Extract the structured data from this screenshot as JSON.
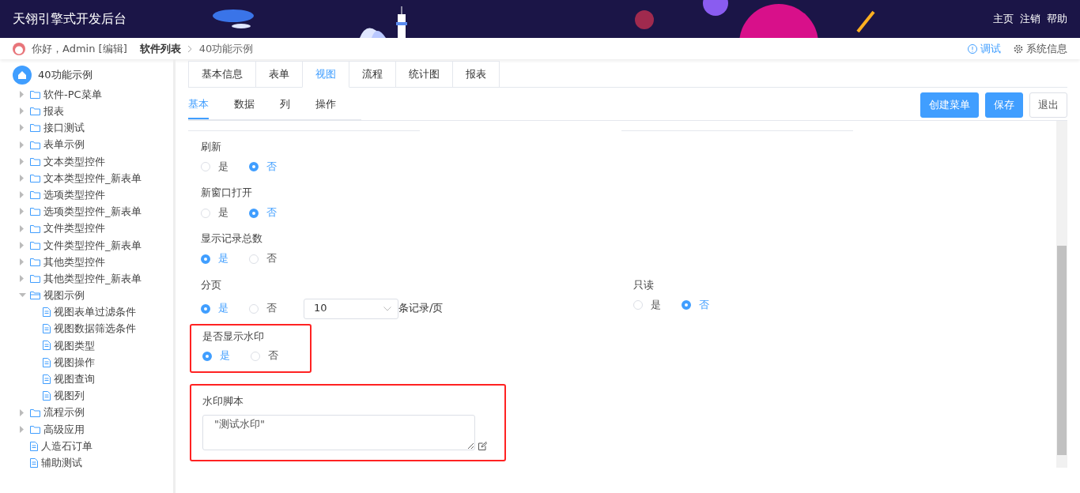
{
  "header": {
    "title": "天翎引擎式开发后台",
    "links": [
      "主页",
      "注销",
      "帮助"
    ]
  },
  "breadcrumb": {
    "greeting": "你好，Admin [编辑]",
    "items": [
      "软件列表",
      "40功能示例"
    ],
    "actions": [
      {
        "kind": "info",
        "label": "调试"
      },
      {
        "kind": "gear",
        "label": "系统信息"
      }
    ]
  },
  "tree": {
    "root": "40功能示例",
    "items": [
      {
        "kind": "folder",
        "label": "软件-PC菜单",
        "expanded": false
      },
      {
        "kind": "folder",
        "label": "报表",
        "expanded": false
      },
      {
        "kind": "folder",
        "label": "接口测试",
        "expanded": false
      },
      {
        "kind": "folder",
        "label": "表单示例",
        "expanded": false
      },
      {
        "kind": "folder",
        "label": "文本类型控件",
        "expanded": false
      },
      {
        "kind": "folder",
        "label": "文本类型控件_新表单",
        "expanded": false
      },
      {
        "kind": "folder",
        "label": "选项类型控件",
        "expanded": false
      },
      {
        "kind": "folder",
        "label": "选项类型控件_新表单",
        "expanded": false
      },
      {
        "kind": "folder",
        "label": "文件类型控件",
        "expanded": false
      },
      {
        "kind": "folder",
        "label": "文件类型控件_新表单",
        "expanded": false
      },
      {
        "kind": "folder",
        "label": "其他类型控件",
        "expanded": false
      },
      {
        "kind": "folder",
        "label": "其他类型控件_新表单",
        "expanded": false
      },
      {
        "kind": "folder",
        "label": "视图示例",
        "expanded": true,
        "children": [
          {
            "kind": "file",
            "label": "视图表单过滤条件"
          },
          {
            "kind": "file",
            "label": "视图数据筛选条件"
          },
          {
            "kind": "file",
            "label": "视图类型"
          },
          {
            "kind": "file",
            "label": "视图操作"
          },
          {
            "kind": "file",
            "label": "视图查询"
          },
          {
            "kind": "file",
            "label": "视图列"
          }
        ]
      },
      {
        "kind": "folder",
        "label": "流程示例",
        "expanded": false
      },
      {
        "kind": "folder",
        "label": "高级应用",
        "expanded": false
      },
      {
        "kind": "file",
        "label": "人造石订单"
      },
      {
        "kind": "file",
        "label": "辅助测试"
      }
    ]
  },
  "tabs": [
    {
      "label": "基本信息",
      "selected": false
    },
    {
      "label": "表单",
      "selected": false
    },
    {
      "label": "视图",
      "selected": true
    },
    {
      "label": "流程",
      "selected": false
    },
    {
      "label": "统计图",
      "selected": false
    },
    {
      "label": "报表",
      "selected": false
    }
  ],
  "subtabs": [
    {
      "label": "基本",
      "selected": true
    },
    {
      "label": "数据",
      "selected": false
    },
    {
      "label": "列",
      "selected": false
    },
    {
      "label": "操作",
      "selected": false
    }
  ],
  "buttons": [
    {
      "label": "创建菜单",
      "kind": "primary"
    },
    {
      "label": "保存",
      "kind": "primary"
    },
    {
      "label": "退出",
      "kind": "default"
    }
  ],
  "form": [
    {
      "kind": "radio",
      "label": "刷新",
      "highlighted": false,
      "options": [
        {
          "label": "是",
          "selected": false
        },
        {
          "label": "否",
          "selected": true
        }
      ]
    },
    {
      "kind": "radio",
      "label": "新窗口打开",
      "highlighted": false,
      "options": [
        {
          "label": "是",
          "selected": false
        },
        {
          "label": "否",
          "selected": true
        }
      ]
    },
    {
      "kind": "radio",
      "label": "显示记录总数",
      "highlighted": false,
      "options": [
        {
          "label": "是",
          "selected": true
        },
        {
          "label": "否",
          "selected": false
        }
      ]
    },
    {
      "kind": "paging",
      "label": "分页",
      "highlighted": false,
      "options": [
        {
          "label": "是",
          "selected": true
        },
        {
          "label": "否",
          "selected": false
        }
      ],
      "select_value": "10",
      "suffix": "条记录/页",
      "side": {
        "label": "只读",
        "options": [
          {
            "label": "是",
            "selected": false
          },
          {
            "label": "否",
            "selected": true
          }
        ]
      }
    },
    {
      "kind": "radio",
      "label": "是否显示水印",
      "highlighted": true,
      "options": [
        {
          "label": "是",
          "selected": true
        },
        {
          "label": "否",
          "selected": false
        }
      ]
    },
    {
      "kind": "textarea",
      "label": "水印脚本",
      "highlighted": true,
      "value": "\"测试水印\""
    }
  ]
}
